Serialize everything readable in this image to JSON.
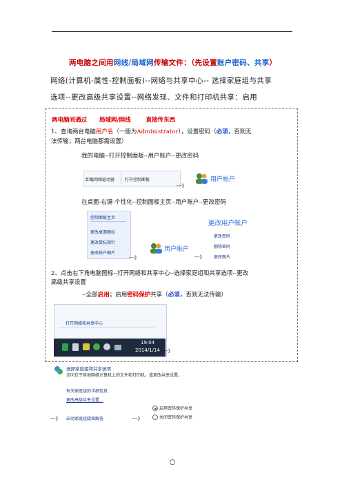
{
  "doc": {
    "title_part1": "两电脑之间用",
    "title_part2": "网线/局域网",
    "title_part3": "传输文件：（先设置",
    "title_part4": "账户密码、共享",
    "title_part5": "）",
    "line2": "网络(计算机-属性-控制面板)--网络与共享中心-- 选择家庭组与共享",
    "line3": "选项--更改高级共享设置--网络发现、文件和打印机共享：启用",
    "box_head_1": "两电脑间通过",
    "box_head_2": "局域网/网线",
    "box_head_3": "直接传东西",
    "step1_a": "1、查询两台电脑",
    "step1_b": "用户名",
    "step1_c": "（一般为",
    "step1_d": "Administrator",
    "step1_e": "），设置密码（",
    "step1_f": "必须",
    "step1_g": "，否则无",
    "step1_line2": "法传输；两台电脑都需设置）",
    "mypc_path": "我的电脑--打开控制面板--用户账户--更改密码",
    "shot1_item1": "卸载网络驱动器",
    "shot1_item2": "打开控制面板",
    "arrow": "---》",
    "user_account": "用户帐户",
    "desktop_path": "在桌面-右键-个性化--控制面板主页--用户账户--更改密码",
    "cp_home": "控制面板主页",
    "cp_items": [
      "更改桌面图标",
      "更改鼠标指针",
      "更改帐户图片"
    ],
    "change_account": "更改用户帐户",
    "change_items": [
      "更改密码",
      "删除密码",
      "更改图片"
    ],
    "step2_line1": "2、点击右下角电脑图标--打开网络和共享中心--选择家庭组和共享选项--更改",
    "step2_line2": "高级共享设置",
    "enable_a": "--全部",
    "enable_b": "启用",
    "enable_c": "；启用",
    "enable_d": "密码保护",
    "enable_e": "共享（",
    "enable_f": "必须",
    "enable_g": "，否则无法传输）",
    "open_network": "打开网络和共享中心",
    "clock_time": "19:04",
    "clock_date": "2014/1/14",
    "hg_title": "选择家庭组和共享选项",
    "hg_desc": "访问位于其他网络计算机上的文件和打印机，或更改共享设置。",
    "hg_link1": "有关家庭组的详细信息",
    "hg_link2": "更改高级共享设置...",
    "hg_link3": "启动家庭组疑难解答",
    "radio1": "启用密码保护共享",
    "radio2": "关闭密码保护共享",
    "page_mark": "〇"
  }
}
